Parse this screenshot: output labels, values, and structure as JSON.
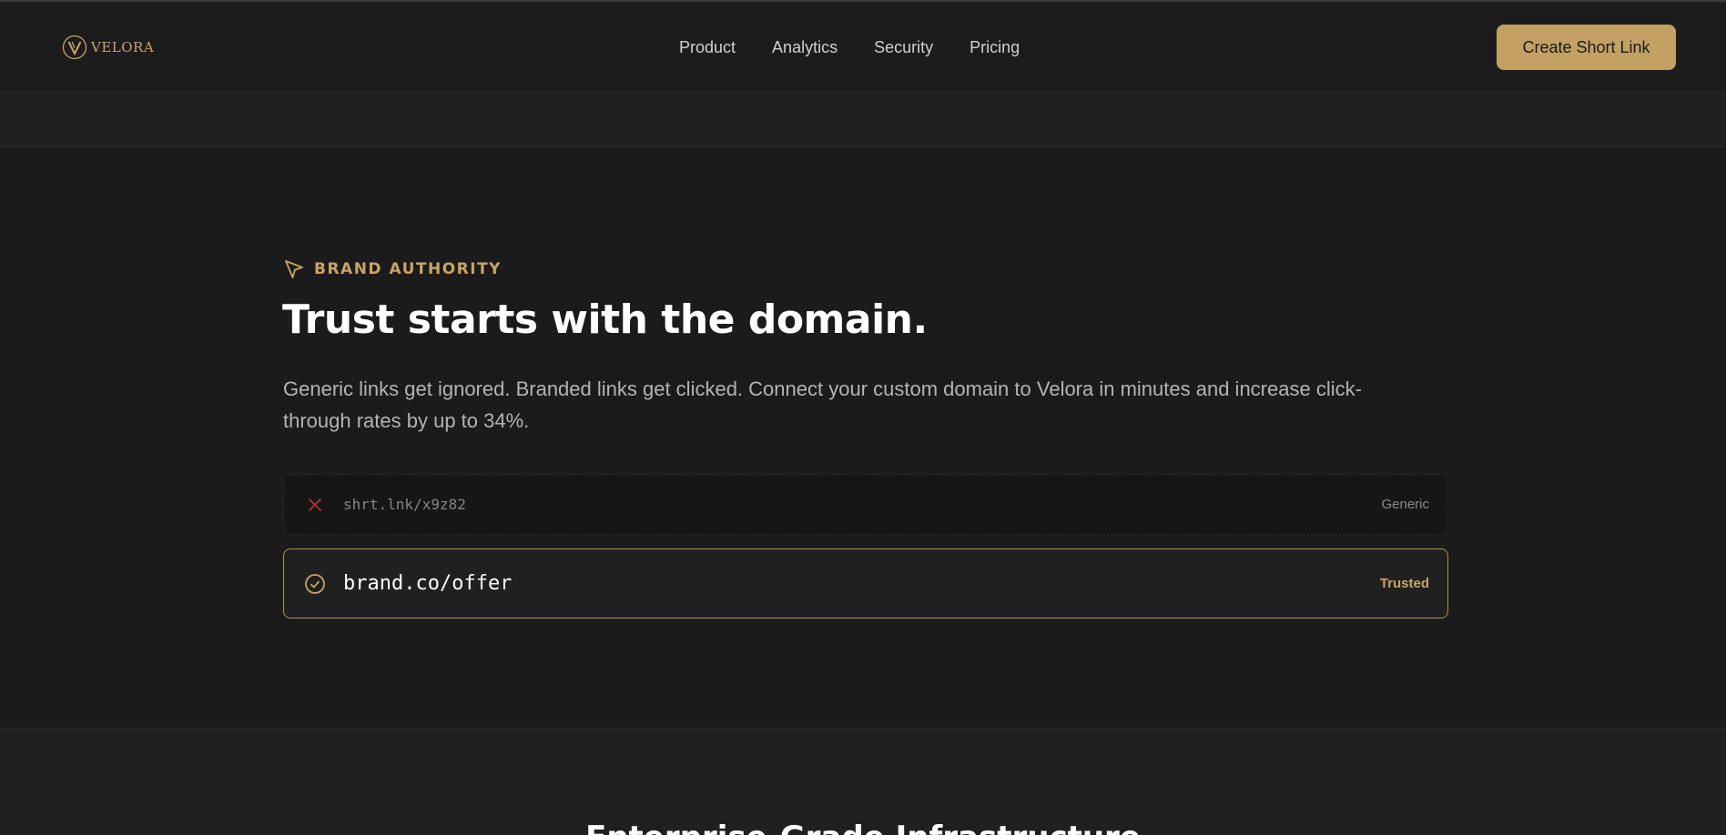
{
  "brand": {
    "name": "VELORA",
    "logo_icon": "v-emblem-icon",
    "accent_color": "#c3a165"
  },
  "nav": {
    "items": [
      {
        "label": "Product"
      },
      {
        "label": "Analytics"
      },
      {
        "label": "Security"
      },
      {
        "label": "Pricing"
      }
    ]
  },
  "header": {
    "cta_label": "Create Short Link"
  },
  "hero": {
    "eyebrow_icon": "cursor-arrow-icon",
    "eyebrow": "BRAND AUTHORITY",
    "headline": "Trust starts with the domain.",
    "lead": "Generic links get ignored. Branded links get clicked. Connect your custom domain to Velora in minutes and increase click-through rates by up to 34%."
  },
  "comparison": {
    "generic": {
      "icon": "x-mark-icon",
      "url": "shrt.lnk/x9z82",
      "tag": "Generic",
      "icon_color": "#b3312b"
    },
    "trusted": {
      "icon": "check-circle-icon",
      "url": "brand.co/offer",
      "tag": "Trusted",
      "icon_color": "#c9a465"
    }
  },
  "next_section": {
    "title": "Enterprise-Grade Infrastructure"
  }
}
